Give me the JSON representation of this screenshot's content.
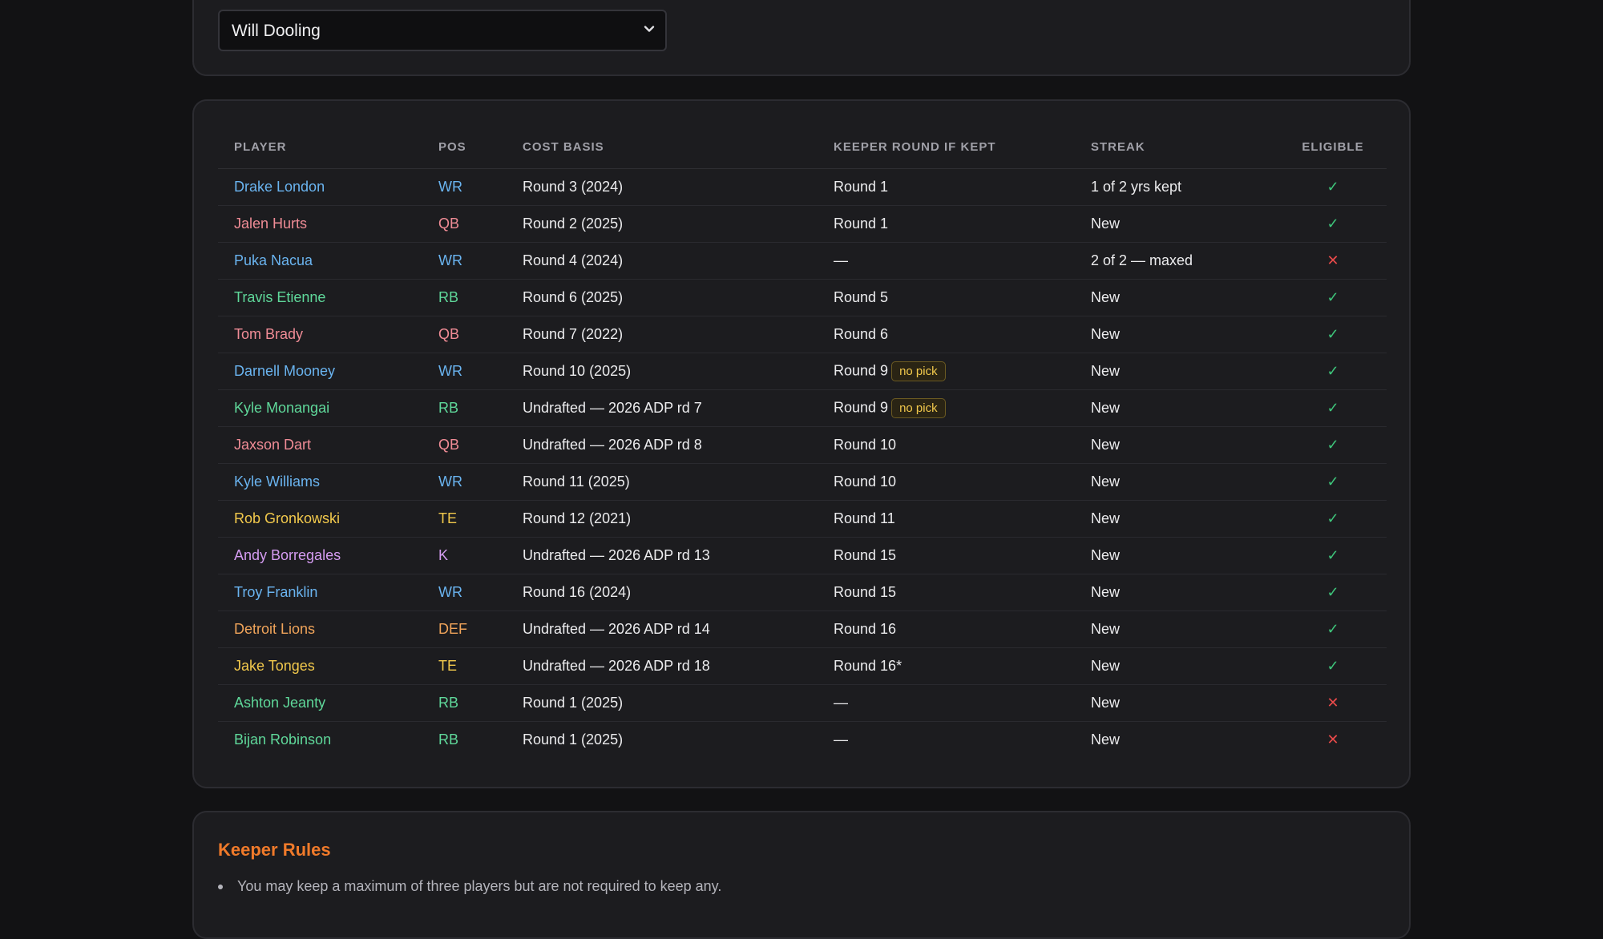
{
  "selector": {
    "value": "Will Dooling",
    "icon": "chevron-down-icon"
  },
  "table": {
    "headers": {
      "player": "PLAYER",
      "pos": "POS",
      "cost": "COST BASIS",
      "keeper": "KEEPER ROUND IF KEPT",
      "streak": "STREAK",
      "eligible": "ELIGIBLE"
    },
    "badge_label": "no pick",
    "rows": [
      {
        "player": "Drake London",
        "pos": "WR",
        "cost": "Round 3 (2024)",
        "keeper": "Round 1",
        "no_pick": false,
        "streak": "1 of 2 yrs kept",
        "eligible": "✓"
      },
      {
        "player": "Jalen Hurts",
        "pos": "QB",
        "cost": "Round 2 (2025)",
        "keeper": "Round 1",
        "no_pick": false,
        "streak": "New",
        "eligible": "✓"
      },
      {
        "player": "Puka Nacua",
        "pos": "WR",
        "cost": "Round 4 (2024)",
        "keeper": "—",
        "no_pick": false,
        "streak": "2 of 2 — maxed",
        "eligible": "✕"
      },
      {
        "player": "Travis Etienne",
        "pos": "RB",
        "cost": "Round 6 (2025)",
        "keeper": "Round 5",
        "no_pick": false,
        "streak": "New",
        "eligible": "✓"
      },
      {
        "player": "Tom Brady",
        "pos": "QB",
        "cost": "Round 7 (2022)",
        "keeper": "Round 6",
        "no_pick": false,
        "streak": "New",
        "eligible": "✓"
      },
      {
        "player": "Darnell Mooney",
        "pos": "WR",
        "cost": "Round 10 (2025)",
        "keeper": "Round 9",
        "no_pick": true,
        "streak": "New",
        "eligible": "✓"
      },
      {
        "player": "Kyle Monangai",
        "pos": "RB",
        "cost": "Undrafted — 2026 ADP rd 7",
        "keeper": "Round 9",
        "no_pick": true,
        "streak": "New",
        "eligible": "✓"
      },
      {
        "player": "Jaxson Dart",
        "pos": "QB",
        "cost": "Undrafted — 2026 ADP rd 8",
        "keeper": "Round 10",
        "no_pick": false,
        "streak": "New",
        "eligible": "✓"
      },
      {
        "player": "Kyle Williams",
        "pos": "WR",
        "cost": "Round 11 (2025)",
        "keeper": "Round 10",
        "no_pick": false,
        "streak": "New",
        "eligible": "✓"
      },
      {
        "player": "Rob Gronkowski",
        "pos": "TE",
        "cost": "Round 12 (2021)",
        "keeper": "Round 11",
        "no_pick": false,
        "streak": "New",
        "eligible": "✓"
      },
      {
        "player": "Andy Borregales",
        "pos": "K",
        "cost": "Undrafted — 2026 ADP rd 13",
        "keeper": "Round 15",
        "no_pick": false,
        "streak": "New",
        "eligible": "✓"
      },
      {
        "player": "Troy Franklin",
        "pos": "WR",
        "cost": "Round 16 (2024)",
        "keeper": "Round 15",
        "no_pick": false,
        "streak": "New",
        "eligible": "✓"
      },
      {
        "player": "Detroit Lions",
        "pos": "DEF",
        "cost": "Undrafted — 2026 ADP rd 14",
        "keeper": "Round 16",
        "no_pick": false,
        "streak": "New",
        "eligible": "✓"
      },
      {
        "player": "Jake Tonges",
        "pos": "TE",
        "cost": "Undrafted — 2026 ADP rd 18",
        "keeper": "Round 16*",
        "no_pick": false,
        "streak": "New",
        "eligible": "✓"
      },
      {
        "player": "Ashton Jeanty",
        "pos": "RB",
        "cost": "Round 1 (2025)",
        "keeper": "—",
        "no_pick": false,
        "streak": "New",
        "eligible": "✕"
      },
      {
        "player": "Bijan Robinson",
        "pos": "RB",
        "cost": "Round 1 (2025)",
        "keeper": "—",
        "no_pick": false,
        "streak": "New",
        "eligible": "✕"
      }
    ]
  },
  "rules": {
    "title": "Keeper Rules",
    "items": [
      "You may keep a maximum of three players but are not required to keep any."
    ]
  },
  "colors": {
    "WR": "#6ab4f0",
    "QB": "#f08c96",
    "RB": "#5fd89a",
    "TE": "#f2c94c",
    "K": "#d59cf2",
    "DEF": "#f0a45a",
    "eligible": "#3ec47a",
    "ineligible": "#e84a4a",
    "accent": "#f07a2a"
  }
}
